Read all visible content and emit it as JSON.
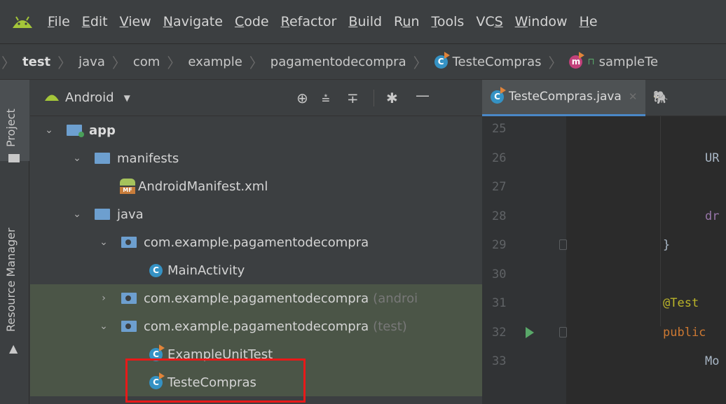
{
  "menubar": {
    "items": [
      {
        "pre": "",
        "ul": "F",
        "post": "ile"
      },
      {
        "pre": "",
        "ul": "E",
        "post": "dit"
      },
      {
        "pre": "",
        "ul": "V",
        "post": "iew"
      },
      {
        "pre": "",
        "ul": "N",
        "post": "avigate"
      },
      {
        "pre": "",
        "ul": "C",
        "post": "ode"
      },
      {
        "pre": "",
        "ul": "R",
        "post": "efactor"
      },
      {
        "pre": "",
        "ul": "B",
        "post": "uild"
      },
      {
        "pre": "R",
        "ul": "u",
        "post": "n"
      },
      {
        "pre": "",
        "ul": "T",
        "post": "ools"
      },
      {
        "pre": "VC",
        "ul": "S",
        "post": ""
      },
      {
        "pre": "",
        "ul": "W",
        "post": "indow"
      },
      {
        "pre": "",
        "ul": "H",
        "post": "e"
      }
    ]
  },
  "breadcrumb": {
    "items": [
      "test",
      "java",
      "com",
      "example",
      "pagamentodecompra",
      "TesteCompras",
      "sampleTe"
    ]
  },
  "toolstrip": {
    "project_label": "Project",
    "resource_manager_label": "Resource Manager"
  },
  "project_panel": {
    "view_selector": "Android",
    "tree": {
      "app": "app",
      "manifests": "manifests",
      "manifest_file": "AndroidManifest.xml",
      "java": "java",
      "pkg_main": "com.example.pagamentodecompra",
      "main_activity": "MainActivity",
      "pkg_android_test": "com.example.pagamentodecompra",
      "pkg_android_test_suffix": "(androi",
      "pkg_test": "com.example.pagamentodecompra",
      "pkg_test_suffix": "(test)",
      "example_unit_test": "ExampleUnitTest",
      "teste_compras": "TesteCompras"
    }
  },
  "editor": {
    "tab_label": "TesteCompras.java",
    "lines": [
      {
        "num": "25",
        "code": ""
      },
      {
        "num": "26",
        "code": "UR"
      },
      {
        "num": "27",
        "code": ""
      },
      {
        "num": "28",
        "code": "dr"
      },
      {
        "num": "29",
        "code": "}"
      },
      {
        "num": "30",
        "code": ""
      },
      {
        "num": "31",
        "code": "@Test"
      },
      {
        "num": "32",
        "code": "public"
      },
      {
        "num": "33",
        "code": "Mo"
      }
    ]
  },
  "colors": {
    "background": "#3c3f41",
    "editor_background": "#2b2b2b",
    "highlight_box": "#e81919",
    "android_green": "#a4c639",
    "keyword": "#cc7832",
    "annotation": "#bbb529"
  }
}
